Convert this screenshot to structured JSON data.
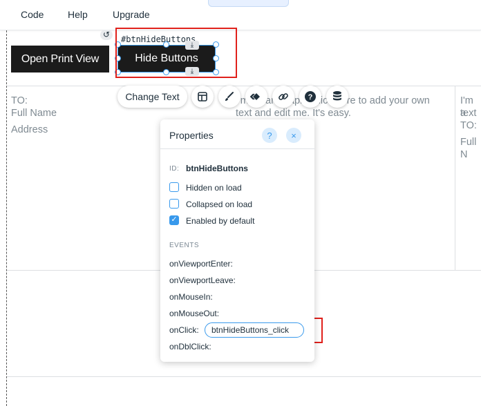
{
  "menu": {
    "items": [
      "Code",
      "Help",
      "Upgrade"
    ],
    "top_tab_glyph": "^"
  },
  "canvas": {
    "print_button_label": "Open Print View",
    "hide_button_label": "Hide Buttons",
    "element_id_label": "#btnHideButtons",
    "left_block": [
      "TO:",
      "Full Name",
      "Address"
    ],
    "middle_block": [
      "I'm a paragraph. Click here to add your own",
      "text and edit me. It's easy."
    ],
    "right_block": [
      "I'm a",
      "text",
      "TO:",
      "Full N"
    ]
  },
  "toolbar": {
    "change_text_label": "Change Text",
    "tools": [
      "layout-icon",
      "brush-icon",
      "animation-icon",
      "link-icon",
      "help-icon",
      "database-icon"
    ]
  },
  "panel": {
    "title": "Properties",
    "help_glyph": "?",
    "close_glyph": "×",
    "id_label": "ID:",
    "id_value": "btnHideButtons",
    "checkboxes": [
      {
        "label": "Hidden on load",
        "checked": false
      },
      {
        "label": "Collapsed on load",
        "checked": false
      },
      {
        "label": "Enabled by default",
        "checked": true
      }
    ],
    "events_heading": "EVENTS",
    "events": [
      "onViewportEnter:",
      "onViewportLeave:",
      "onMouseIn:",
      "onMouseOut:",
      "onClick:",
      "onDblClick:"
    ],
    "onclick_handler": "btnHideButtons_click"
  },
  "colors": {
    "accent": "#3899ec",
    "highlight": "#e0201b",
    "button_bg": "#1b1b1b"
  }
}
